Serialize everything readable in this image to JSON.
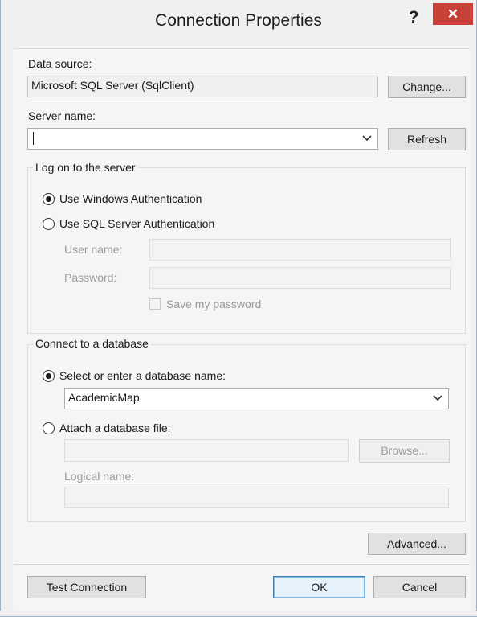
{
  "window": {
    "title": "Connection Properties",
    "help_glyph": "?",
    "close_glyph": "✕",
    "accent_color": "#c84139"
  },
  "data_source": {
    "label": "Data source:",
    "value": "Microsoft SQL Server (SqlClient)",
    "change_button": "Change..."
  },
  "server": {
    "label": "Server name:",
    "value": "",
    "refresh_button": "Refresh"
  },
  "logon": {
    "group_title": "Log on to the server",
    "windows_auth_label": "Use Windows Authentication",
    "sql_auth_label": "Use SQL Server Authentication",
    "selected": "windows",
    "username_label": "User name:",
    "username_value": "",
    "password_label": "Password:",
    "password_value": "",
    "save_password_label": "Save my password",
    "save_password_checked": false
  },
  "database": {
    "group_title": "Connect to a database",
    "select_label": "Select or enter a database name:",
    "database_name": "AcademicMap",
    "attach_label": "Attach a database file:",
    "attach_value": "",
    "browse_button": "Browse...",
    "logical_name_label": "Logical name:",
    "logical_name_value": "",
    "selected": "select"
  },
  "footer": {
    "advanced_button": "Advanced...",
    "test_button": "Test Connection",
    "ok_button": "OK",
    "cancel_button": "Cancel"
  }
}
